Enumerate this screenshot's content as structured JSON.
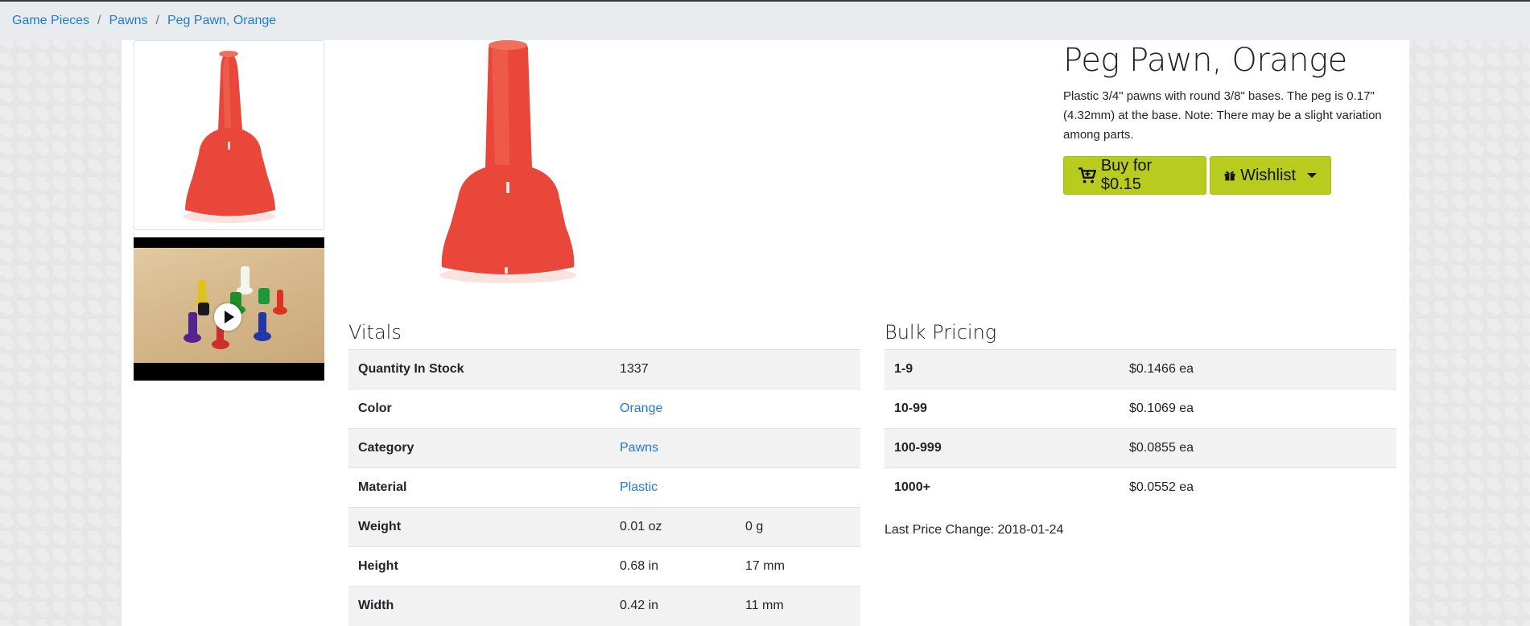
{
  "breadcrumb": {
    "items": [
      "Game Pieces",
      "Pawns",
      "Peg Pawn, Orange"
    ],
    "separator": "/"
  },
  "product": {
    "title": "Peg Pawn, Orange",
    "description": "Plastic 3/4\" pawns with round 3/8\" bases. The peg is 0.17\" (4.32mm) at the base. Note: There may be a slight variation among parts.",
    "buy_label": "Buy for $0.15",
    "wishlist_label": "Wishlist",
    "accent_color": "#b7cc1f",
    "pawn_color": "#e8473a",
    "video_thumbnail_icon": "play-icon"
  },
  "vitals": {
    "title": "Vitals",
    "rows": [
      {
        "label": "Quantity In Stock",
        "value": "1337",
        "value2": ""
      },
      {
        "label": "Color",
        "value": "Orange",
        "value2": ""
      },
      {
        "label": "Category",
        "value": "Pawns",
        "value2": ""
      },
      {
        "label": "Material",
        "value": "Plastic",
        "value2": ""
      },
      {
        "label": "Weight",
        "value": "0.01 oz",
        "value2": "0 g"
      },
      {
        "label": "Height",
        "value": "0.68 in",
        "value2": "17 mm"
      },
      {
        "label": "Width",
        "value": "0.42 in",
        "value2": "11 mm"
      }
    ]
  },
  "bulk": {
    "title": "Bulk Pricing",
    "rows": [
      {
        "qty": "1-9",
        "price": "$0.1466 ea"
      },
      {
        "qty": "10-99",
        "price": "$0.1069 ea"
      },
      {
        "qty": "100-999",
        "price": "$0.0855 ea"
      },
      {
        "qty": "1000+",
        "price": "$0.0552 ea"
      }
    ],
    "last_change": "Last Price Change: 2018-01-24"
  }
}
